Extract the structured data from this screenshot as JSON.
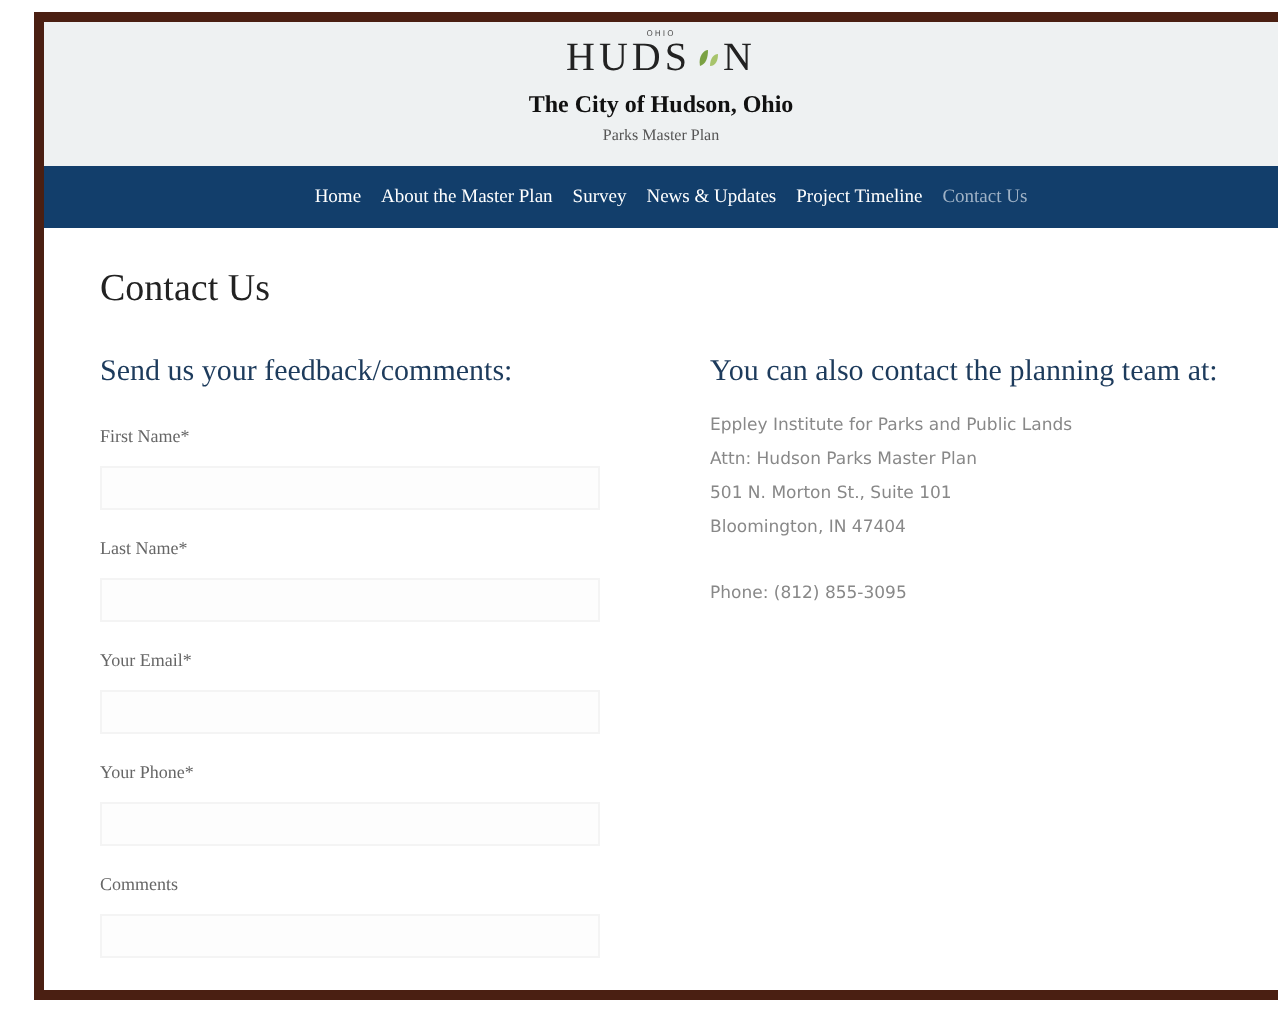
{
  "header": {
    "logo": {
      "kicker": "OHIO",
      "left": "HUDS",
      "right": "N"
    },
    "title": "The City of Hudson, Ohio",
    "subtitle": "Parks Master Plan"
  },
  "nav": [
    {
      "label": "Home",
      "selected": false
    },
    {
      "label": "About the Master Plan",
      "selected": false
    },
    {
      "label": "Survey",
      "selected": false
    },
    {
      "label": "News & Updates",
      "selected": false
    },
    {
      "label": "Project Timeline",
      "selected": false
    },
    {
      "label": "Contact Us",
      "selected": true
    }
  ],
  "page_title": "Contact Us",
  "form": {
    "heading": "Send us your feedback/comments:",
    "fields": [
      {
        "label": "First Name*"
      },
      {
        "label": "Last Name*"
      },
      {
        "label": "Your Email*"
      },
      {
        "label": "Your Phone*"
      },
      {
        "label": "Comments"
      }
    ]
  },
  "contact": {
    "heading": "You can also contact the planning team at:",
    "address": [
      "Eppley Institute for Parks and Public Lands",
      "Attn: Hudson Parks Master Plan",
      "501 N. Morton St., Suite 101",
      "Bloomington, IN 47404"
    ],
    "phone": "Phone: (812) 855-3095"
  }
}
